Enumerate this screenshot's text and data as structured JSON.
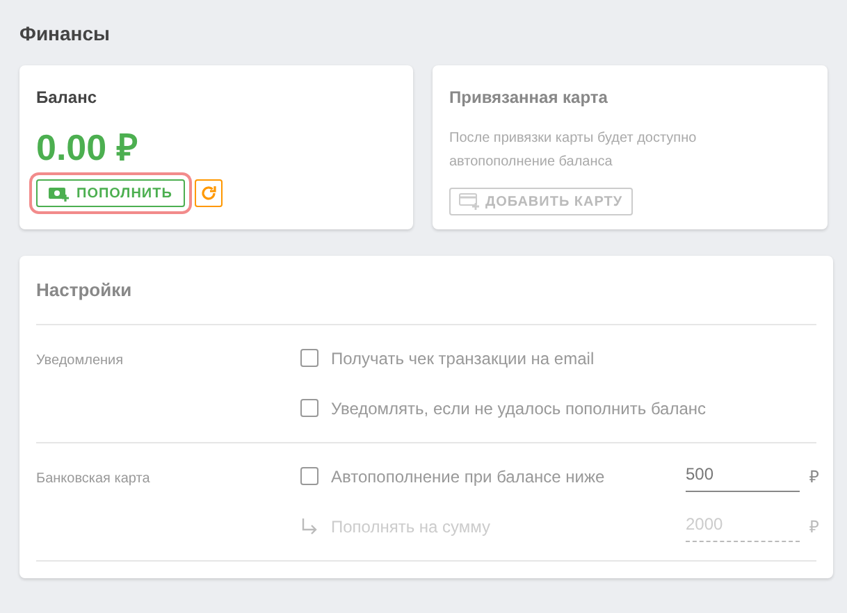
{
  "title": "Финансы",
  "balance_card": {
    "title": "Баланс",
    "amount": "0.00 ₽",
    "topup_button": {
      "label": "ПОПОЛНИТЬ",
      "highlighted": true
    }
  },
  "card_card": {
    "title": "Привязанная карта",
    "description": "После привязки карты будет доступно автопополнение баланса",
    "add_button": {
      "label": "ДОБАВИТЬ КАРТУ",
      "disabled": true
    }
  },
  "settings": {
    "title": "Настройки",
    "groups": [
      {
        "label": "Уведомления",
        "rows": [
          {
            "kind": "checkbox",
            "label": "Получать чек транзакции на email",
            "checked": false
          },
          {
            "kind": "checkbox",
            "label": "Уведомлять, если не удалось пополнить баланс",
            "checked": false
          }
        ]
      },
      {
        "label": "Банковская карта",
        "rows": [
          {
            "kind": "checkbox",
            "label": "Автопополнение при балансе ниже",
            "checked": false,
            "value": "500",
            "currency": "₽",
            "disabled": false
          },
          {
            "kind": "sub",
            "label": "Пополнять на сумму",
            "value": "2000",
            "currency": "₽",
            "disabled": true
          }
        ]
      }
    ]
  }
}
